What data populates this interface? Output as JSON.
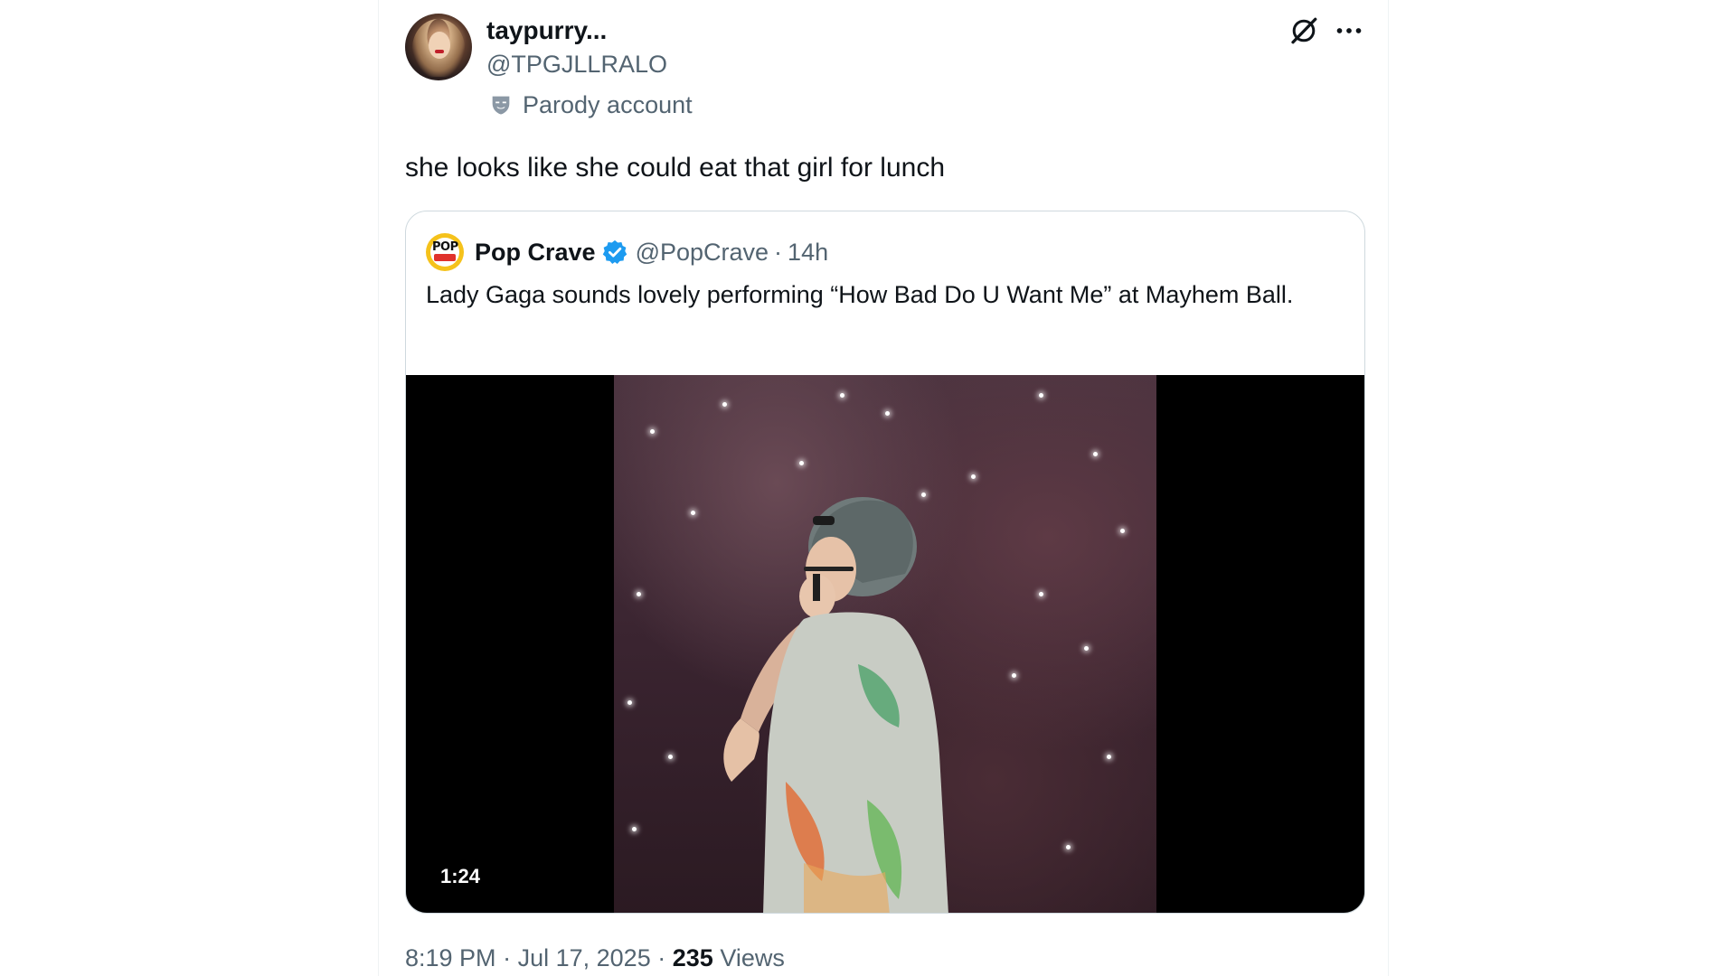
{
  "author": {
    "display_name": "taypurry...",
    "handle": "@TPGJLLRALO",
    "label": "Parody account"
  },
  "tweet": {
    "text": "she looks like she could eat that girl for lunch",
    "time": "8:19 PM",
    "date": "Jul 17, 2025",
    "separator": "·",
    "views_count": "235",
    "views_label": "Views"
  },
  "quoted": {
    "name": "Pop Crave",
    "handle": "@PopCrave",
    "separator": "·",
    "age": "14h",
    "text": "Lady Gaga sounds lovely performing “How Bad Do U Want Me” at Mayhem Ball.",
    "avatar_text": "POP",
    "video": {
      "duration": "1:24"
    }
  },
  "icons": {
    "grok": "grok-icon",
    "more": "more-icon",
    "parody": "parody-mask-icon",
    "verified": "verified-badge-icon"
  },
  "colors": {
    "text_primary": "#0f1419",
    "text_secondary": "#536471",
    "verified_blue": "#1d9bf0",
    "border": "#cfd9de"
  }
}
